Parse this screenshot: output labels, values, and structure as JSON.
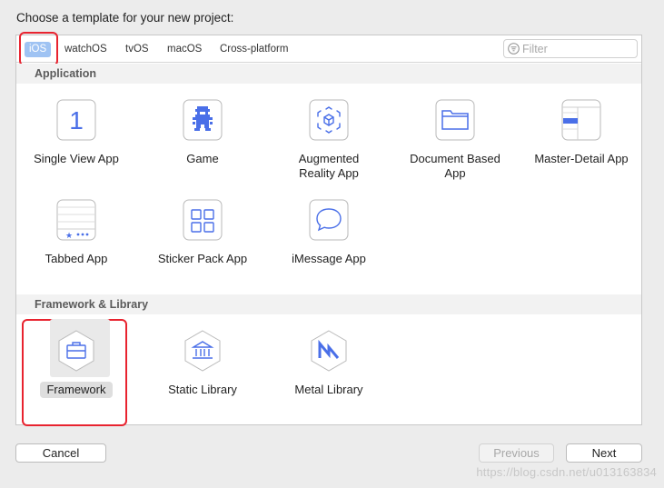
{
  "header": {
    "title": "Choose a template for your new project:"
  },
  "tabs": [
    {
      "label": "iOS",
      "active": true
    },
    {
      "label": "watchOS"
    },
    {
      "label": "tvOS"
    },
    {
      "label": "macOS"
    },
    {
      "label": "Cross-platform"
    }
  ],
  "filter": {
    "placeholder": "Filter",
    "icon": "filter-icon"
  },
  "sections": {
    "application": {
      "title": "Application",
      "items": [
        {
          "label": "Single View App",
          "icon": "single-view-app-icon"
        },
        {
          "label": "Game",
          "icon": "game-icon"
        },
        {
          "label": "Augmented\nReality App",
          "icon": "augmented-reality-icon"
        },
        {
          "label": "Document Based\nApp",
          "icon": "document-based-app-icon"
        },
        {
          "label": "Master-Detail App",
          "icon": "master-detail-app-icon"
        },
        {
          "label": "Tabbed App",
          "icon": "tabbed-app-icon"
        },
        {
          "label": "Sticker Pack App",
          "icon": "sticker-pack-icon"
        },
        {
          "label": "iMessage App",
          "icon": "imessage-app-icon"
        }
      ]
    },
    "framework": {
      "title": "Framework & Library",
      "items": [
        {
          "label": "Framework",
          "icon": "framework-icon",
          "selected": true
        },
        {
          "label": "Static Library",
          "icon": "static-library-icon"
        },
        {
          "label": "Metal Library",
          "icon": "metal-library-icon"
        }
      ]
    }
  },
  "buttons": {
    "cancel": "Cancel",
    "previous": "Previous",
    "next": "Next"
  },
  "watermark": "https://blog.csdn.net/u013163834",
  "colors": {
    "accent": "#4a6fe8",
    "tab_active_bg": "#9fc3f3",
    "highlight": "#e8232f"
  }
}
